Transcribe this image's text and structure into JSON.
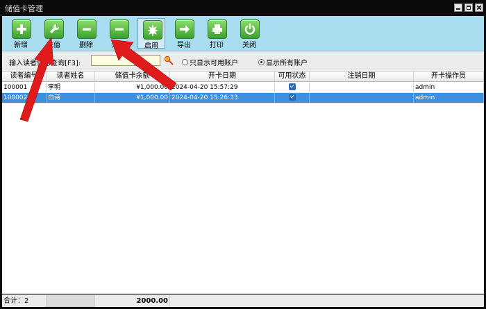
{
  "window": {
    "title": "储值卡管理"
  },
  "toolbar": {
    "buttons": [
      {
        "label": "新增",
        "icon": "plus-icon"
      },
      {
        "label": "充值",
        "icon": "wrench-icon"
      },
      {
        "label": "删除",
        "icon": "minus-icon"
      },
      {
        "label": "注销",
        "icon": "minus-icon"
      },
      {
        "label": "启用",
        "icon": "spark-icon"
      },
      {
        "label": "导出",
        "icon": "arrow-right-icon"
      },
      {
        "label": "打印",
        "icon": "printer-icon"
      },
      {
        "label": "关闭",
        "icon": "power-icon"
      }
    ]
  },
  "filter": {
    "label": "输入读者信息查询[F3]:",
    "value": "",
    "radio_available": "只显示可用账户",
    "radio_all": "显示所有账户"
  },
  "table": {
    "headers": [
      "读者编号",
      "读者姓名",
      "储值卡余额",
      "开卡日期",
      "可用状态",
      "注销日期",
      "开卡操作员"
    ],
    "rows": [
      {
        "id": "100001",
        "name": "李明",
        "balance": "¥1,000.00",
        "open_date": "2024-04-20 15:57:29",
        "active": true,
        "cancel_date": "",
        "operator": "admin"
      },
      {
        "id": "100002",
        "name": "白诗",
        "balance": "¥1,000.00",
        "open_date": "2024-04-20 15:26:33",
        "active": true,
        "cancel_date": "",
        "operator": "admin"
      }
    ]
  },
  "footer": {
    "count_label": "合计：2",
    "total": "2000.00"
  },
  "colors": {
    "toolbar": "#a8dcef",
    "selection": "#3d8fe0",
    "arrow": "#e01b1b"
  }
}
